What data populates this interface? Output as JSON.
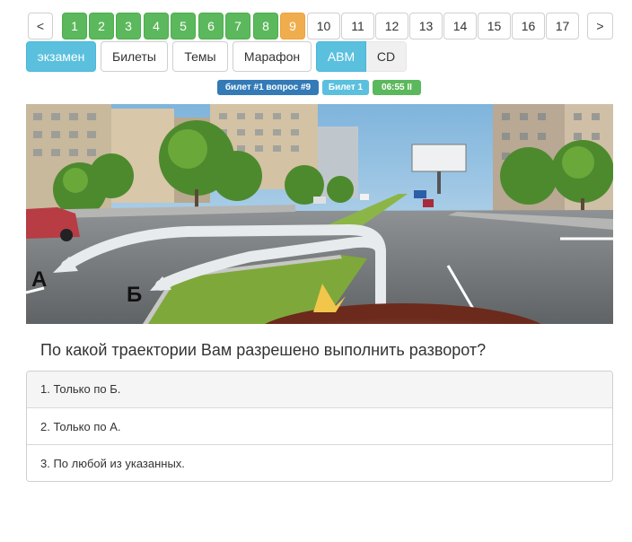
{
  "pagination": {
    "prev": "<",
    "next": ">",
    "pages": [
      "1",
      "2",
      "3",
      "4",
      "5",
      "6",
      "7",
      "8",
      "9",
      "10",
      "11",
      "12",
      "13",
      "14",
      "15",
      "16",
      "17"
    ],
    "completed_color": "#5cb85c",
    "current_color": "#f0ad4e"
  },
  "modes": {
    "exam": "экзамен",
    "tickets": "Билеты",
    "topics": "Темы",
    "marathon": "Марафон",
    "category_abm": "ABM",
    "category_cd": "CD"
  },
  "status": {
    "ticket_question": "билет #1 вопрос #9",
    "ticket": "Билет 1",
    "timer": "06:55 II"
  },
  "scene": {
    "label_a": "А",
    "label_b": "Б"
  },
  "question": {
    "text": "По какой траектории Вам разрешено выполнить разворот?"
  },
  "answers": [
    "1. Только по Б.",
    "2. Только по А.",
    "3. По любой из указанных."
  ]
}
